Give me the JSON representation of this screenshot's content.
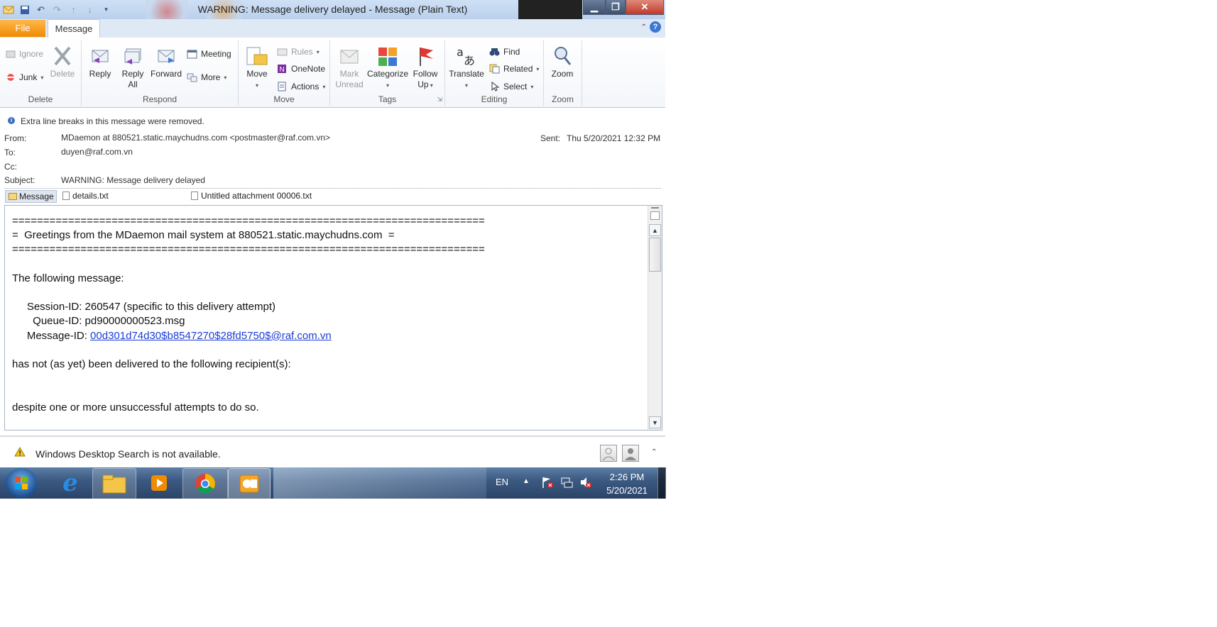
{
  "window": {
    "title": "WARNING: Message delivery delayed  -  Message (Plain Text)"
  },
  "tabs": {
    "file": "File",
    "message": "Message"
  },
  "ribbon": {
    "delete_group": {
      "label": "Delete",
      "ignore": "Ignore",
      "junk": "Junk",
      "delete": "Delete"
    },
    "respond_group": {
      "label": "Respond",
      "reply": "Reply",
      "reply_all_1": "Reply",
      "reply_all_2": "All",
      "forward": "Forward",
      "meeting": "Meeting",
      "more": "More"
    },
    "move_group": {
      "label": "Move",
      "move": "Move",
      "rules": "Rules",
      "onenote": "OneNote",
      "actions": "Actions"
    },
    "tags_group": {
      "label": "Tags",
      "mark_unread_1": "Mark",
      "mark_unread_2": "Unread",
      "categorize": "Categorize",
      "follow_up_1": "Follow",
      "follow_up_2": "Up"
    },
    "editing_group": {
      "label": "Editing",
      "translate": "Translate",
      "find": "Find",
      "related": "Related",
      "select": "Select"
    },
    "zoom_group": {
      "label": "Zoom",
      "zoom": "Zoom"
    }
  },
  "info_bar": "Extra line breaks in this message were removed.",
  "header": {
    "from_label": "From:",
    "from_value": "MDaemon at 880521.static.maychudns.com <postmaster@raf.com.vn>",
    "sent_label": "Sent:",
    "sent_value": "Thu 5/20/2021 12:32 PM",
    "to_label": "To:",
    "to_value": "duyen@raf.com.vn",
    "cc_label": "Cc:",
    "subject_label": "Subject:",
    "subject_value": "WARNING: Message delivery delayed"
  },
  "attachments": [
    {
      "name": "Message"
    },
    {
      "name": "details.txt"
    },
    {
      "name": "Untitled attachment 00006.txt"
    }
  ],
  "body": {
    "rule_line": "============================================================================",
    "greeting": "=  Greetings from the MDaemon mail system at 880521.static.maychudns.com  =",
    "following": "The following message:",
    "session": "     Session-ID: 260547 (specific to this delivery attempt)",
    "queue": "       Queue-ID: pd90000000523.msg",
    "message_id_label": "     Message-ID: ",
    "message_id_link": "00d301d74d30$b8547270$28fd5750$@raf.com.vn",
    "not_delivered": "has not (as yet) been delivered to the following recipient(s):",
    "despite": "despite one or more unsuccessful attempts to do so."
  },
  "status_bar": {
    "text": "Windows Desktop Search is not available."
  },
  "taskbar": {
    "language": "EN",
    "time": "2:26 PM",
    "date": "5/20/2021"
  },
  "colors": {
    "file_tab": "#f08a00",
    "link": "#1a3cd6",
    "taskbar": "#3c5a82"
  }
}
